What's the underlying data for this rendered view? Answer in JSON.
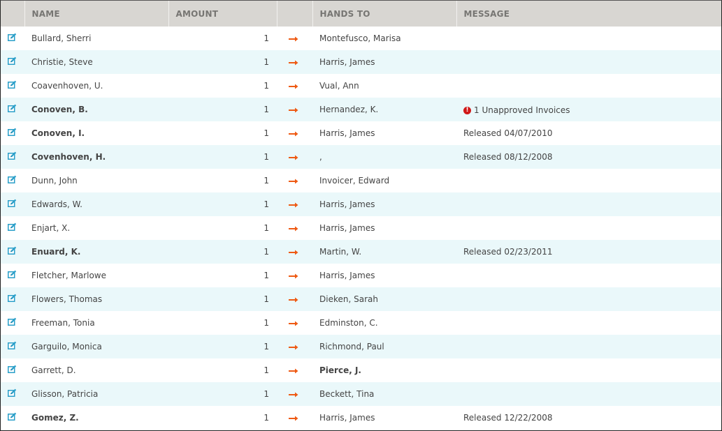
{
  "table": {
    "columns": [
      {
        "key": "edit",
        "label": ""
      },
      {
        "key": "name",
        "label": "NAME"
      },
      {
        "key": "amount",
        "label": "AMOUNT"
      },
      {
        "key": "arrow",
        "label": ""
      },
      {
        "key": "hands_to",
        "label": "HANDS TO"
      },
      {
        "key": "message",
        "label": "MESSAGE"
      }
    ],
    "icons": {
      "edit": "edit-icon",
      "arrow": "arrow-right-icon",
      "alert": "exclamation-circle-icon"
    },
    "colors": {
      "highlight": "#ee5a14",
      "header_bg": "#d8d6d2",
      "row_alt_bg": "#eaf8fa",
      "edit_icon": "#2a9fc9",
      "alert": "#d01818"
    },
    "rows": [
      {
        "name": "Bullard, Sherri",
        "name_highlight": false,
        "amount": "1",
        "hands_to": "Montefusco, Marisa",
        "hands_to_highlight": false,
        "message": "",
        "message_alert": false
      },
      {
        "name": "Christie, Steve",
        "name_highlight": false,
        "amount": "1",
        "hands_to": "Harris, James",
        "hands_to_highlight": false,
        "message": "",
        "message_alert": false
      },
      {
        "name": "Coavenhoven, U.",
        "name_highlight": false,
        "amount": "1",
        "hands_to": "Vual, Ann",
        "hands_to_highlight": false,
        "message": "",
        "message_alert": false
      },
      {
        "name": "Conoven, B.",
        "name_highlight": true,
        "amount": "1",
        "hands_to": "Hernandez, K.",
        "hands_to_highlight": false,
        "message": "1 Unapproved Invoices",
        "message_alert": true
      },
      {
        "name": "Conoven, I.",
        "name_highlight": true,
        "amount": "1",
        "hands_to": "Harris, James",
        "hands_to_highlight": false,
        "message": "Released 04/07/2010",
        "message_alert": false
      },
      {
        "name": "Covenhoven, H.",
        "name_highlight": true,
        "amount": "1",
        "hands_to": ",",
        "hands_to_highlight": false,
        "message": "Released 08/12/2008",
        "message_alert": false
      },
      {
        "name": "Dunn, John",
        "name_highlight": false,
        "amount": "1",
        "hands_to": "Invoicer, Edward",
        "hands_to_highlight": false,
        "message": "",
        "message_alert": false
      },
      {
        "name": "Edwards, W.",
        "name_highlight": false,
        "amount": "1",
        "hands_to": "Harris, James",
        "hands_to_highlight": false,
        "message": "",
        "message_alert": false
      },
      {
        "name": "Enjart, X.",
        "name_highlight": false,
        "amount": "1",
        "hands_to": "Harris, James",
        "hands_to_highlight": false,
        "message": "",
        "message_alert": false
      },
      {
        "name": "Enuard, K.",
        "name_highlight": true,
        "amount": "1",
        "hands_to": "Martin, W.",
        "hands_to_highlight": false,
        "message": "Released 02/23/2011",
        "message_alert": false
      },
      {
        "name": "Fletcher, Marlowe",
        "name_highlight": false,
        "amount": "1",
        "hands_to": "Harris, James",
        "hands_to_highlight": false,
        "message": "",
        "message_alert": false
      },
      {
        "name": "Flowers, Thomas",
        "name_highlight": false,
        "amount": "1",
        "hands_to": "Dieken, Sarah",
        "hands_to_highlight": false,
        "message": "",
        "message_alert": false
      },
      {
        "name": "Freeman, Tonia",
        "name_highlight": false,
        "amount": "1",
        "hands_to": "Edminston, C.",
        "hands_to_highlight": false,
        "message": "",
        "message_alert": false
      },
      {
        "name": "Garguilo, Monica",
        "name_highlight": false,
        "amount": "1",
        "hands_to": "Richmond, Paul",
        "hands_to_highlight": false,
        "message": "",
        "message_alert": false
      },
      {
        "name": "Garrett, D.",
        "name_highlight": false,
        "amount": "1",
        "hands_to": "Pierce, J.",
        "hands_to_highlight": true,
        "message": "",
        "message_alert": false
      },
      {
        "name": "Glisson, Patricia",
        "name_highlight": false,
        "amount": "1",
        "hands_to": "Beckett, Tina",
        "hands_to_highlight": false,
        "message": "",
        "message_alert": false
      },
      {
        "name": "Gomez, Z.",
        "name_highlight": true,
        "amount": "1",
        "hands_to": "Harris, James",
        "hands_to_highlight": false,
        "message": "Released 12/22/2008",
        "message_alert": false
      }
    ]
  }
}
